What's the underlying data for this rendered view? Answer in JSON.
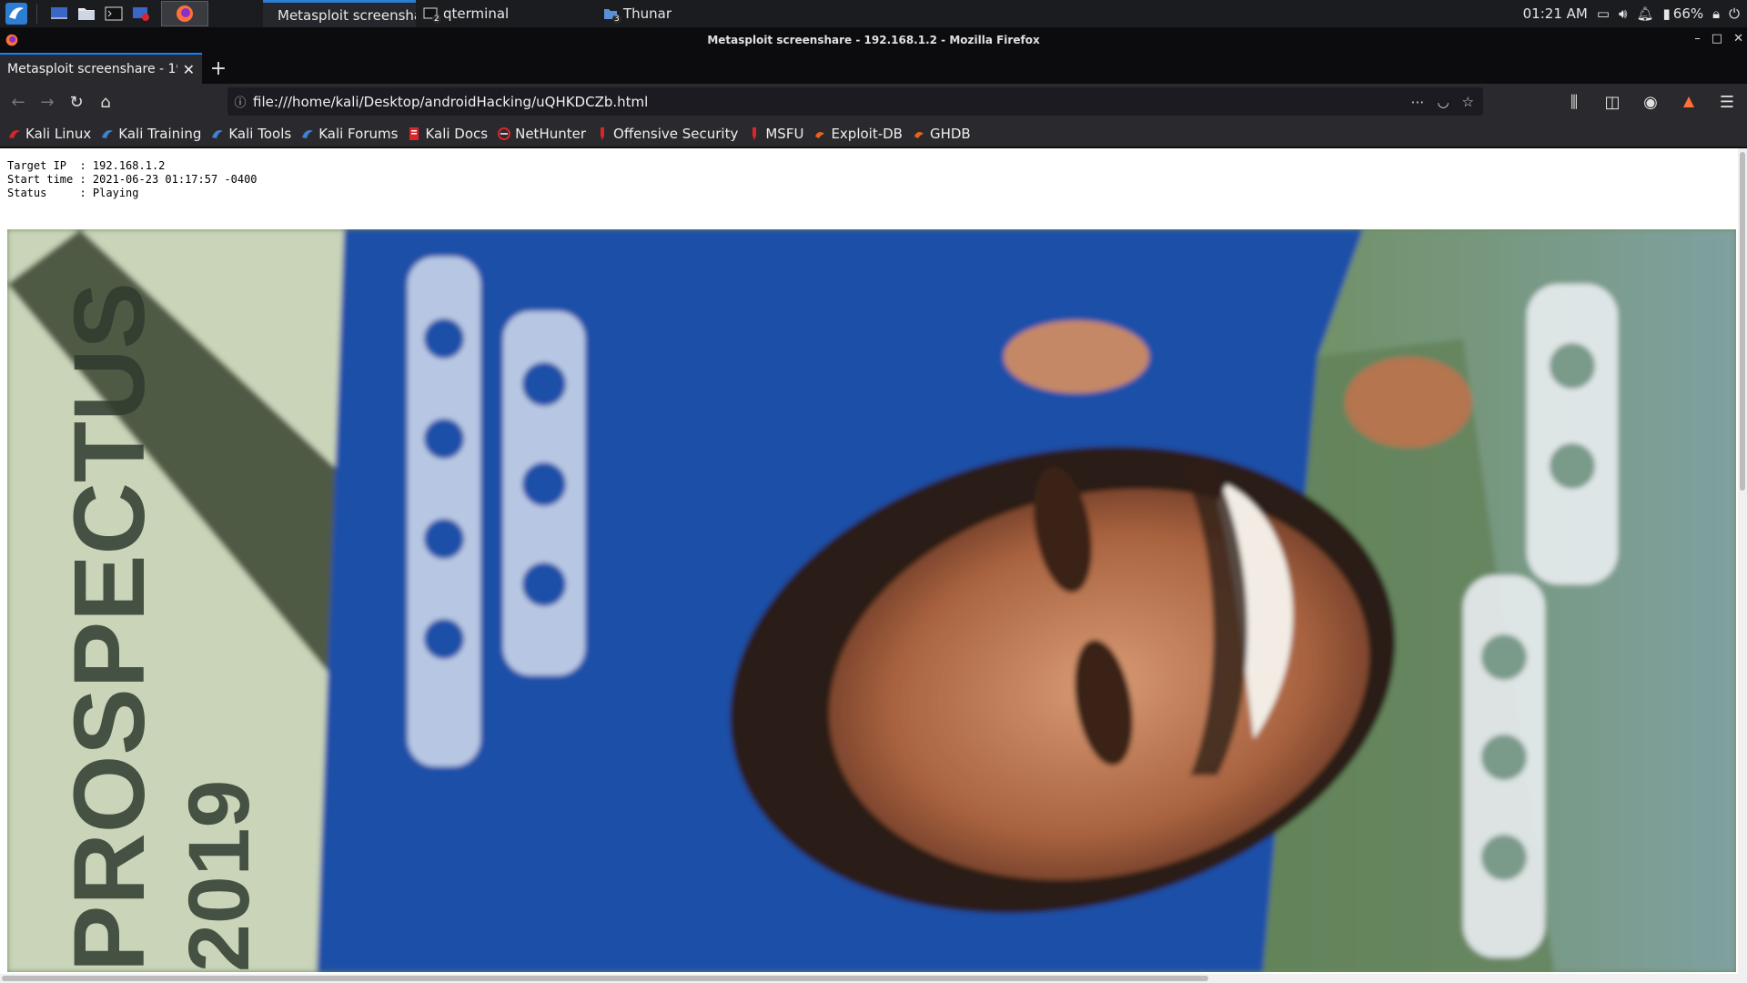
{
  "taskbar": {
    "tasks": [
      {
        "label": "Metasploit screenshare ...",
        "active": true
      },
      {
        "label": "qterminal",
        "badge": "2"
      },
      {
        "label": "Thunar",
        "badge": "3"
      }
    ],
    "clock": "01:21 AM",
    "battery": "66%"
  },
  "window": {
    "title": "Metasploit screenshare - 192.168.1.2 - Mozilla Firefox"
  },
  "tab": {
    "label": "Metasploit screenshare - 192.168.1.2"
  },
  "urlbar": {
    "url": "file:///home/kali/Desktop/androidHacking/uQHKDCZb.html"
  },
  "bookmarks": [
    {
      "label": "Kali Linux",
      "icon": "kali-dragon-red"
    },
    {
      "label": "Kali Training",
      "icon": "kali-dragon-blue"
    },
    {
      "label": "Kali Tools",
      "icon": "kali-dragon-blue"
    },
    {
      "label": "Kali Forums",
      "icon": "kali-dragon-blue"
    },
    {
      "label": "Kali Docs",
      "icon": "docs-red"
    },
    {
      "label": "NetHunter",
      "icon": "nethunter-red"
    },
    {
      "label": "Offensive Security",
      "icon": "offsec-red"
    },
    {
      "label": "MSFU",
      "icon": "msfu-red"
    },
    {
      "label": "Exploit-DB",
      "icon": "exploitdb-orange"
    },
    {
      "label": "GHDB",
      "icon": "ghdb-orange"
    }
  ],
  "page": {
    "info_lines": [
      "Target IP  : 192.168.1.2",
      "Start time : 2021-06-23 01:17:57 -0400",
      "Status     : Playing"
    ]
  },
  "screenshot_text": {
    "left_text": "PROSPECTUS",
    "left_year": "2019"
  },
  "colors": {
    "accent": "#0a84ff",
    "taskbar_bg": "#1b1c20",
    "toolbar_bg": "#2a2a2e",
    "kali_red": "#d9262b",
    "kali_blue": "#3d84d6"
  }
}
